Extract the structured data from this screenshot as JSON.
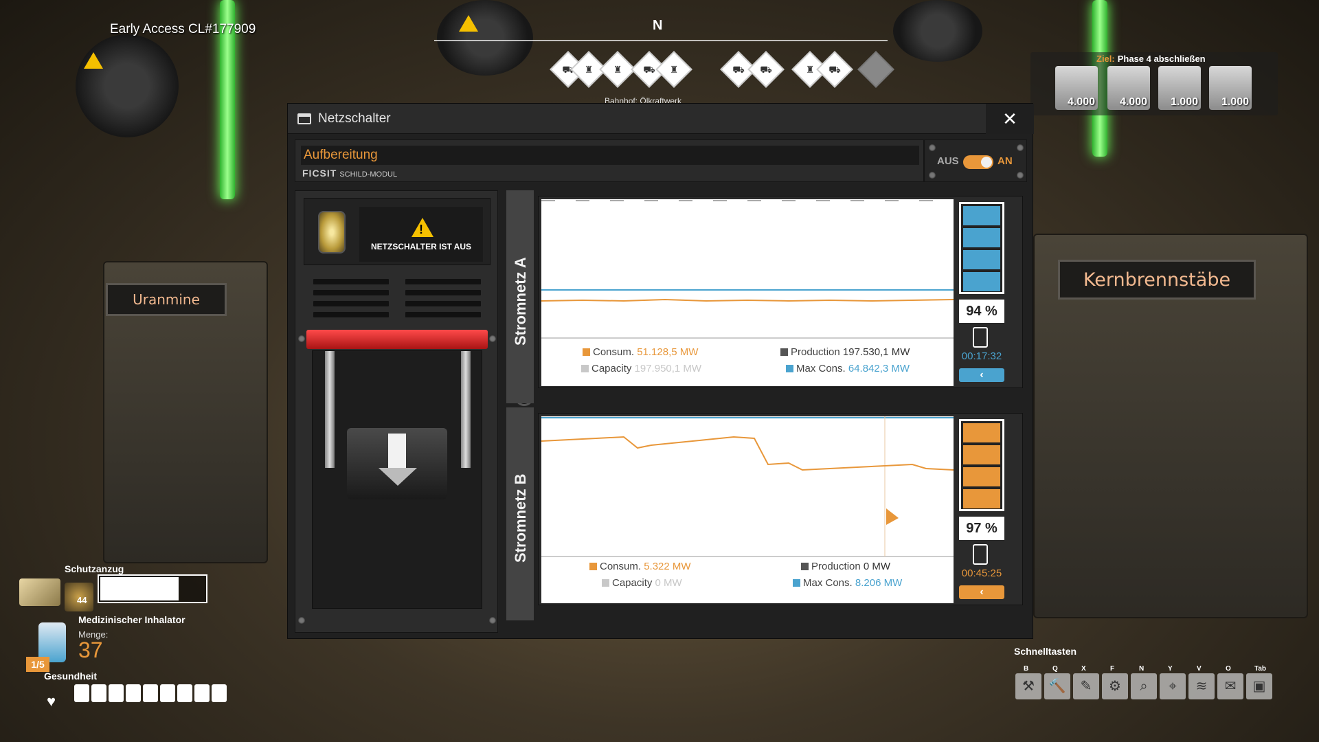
{
  "hud": {
    "build": "Early Access CL#177909",
    "compass_heading": "N",
    "compass_label": "Bahnhof: Ölkraftwerk",
    "goal": {
      "label": "Ziel:",
      "title": "Phase 4 abschließen",
      "items": [
        {
          "count": "4.000",
          "icon": "motor-icon"
        },
        {
          "count": "4.000",
          "icon": "turbomotor-icon"
        },
        {
          "count": "1.000",
          "icon": "modular-frame-icon"
        },
        {
          "count": "1.000",
          "icon": "nuclear-pasta-icon"
        }
      ]
    },
    "bg_signs": {
      "left": "Uranmine",
      "right": "Kernbrennstäbe"
    },
    "player": {
      "suit_label": "Schutzanzug",
      "suit_count": "44",
      "suit_level": 0.72,
      "inhaler_label": "Medizinischer Inhalator",
      "menge_label": "Menge:",
      "menge_value": "37",
      "inhaler_slot": "1/5",
      "health_label": "Gesundheit",
      "health_segments": 9
    },
    "quickbar": {
      "label": "Schnelltasten",
      "slots": [
        {
          "key": "B",
          "icon": "build-gun-icon",
          "glyph": "⚒"
        },
        {
          "key": "Q",
          "icon": "hammer-icon",
          "glyph": "🔨"
        },
        {
          "key": "X",
          "icon": "paint-brush-icon",
          "glyph": "✎"
        },
        {
          "key": "F",
          "icon": "factory-icon",
          "glyph": "⚙"
        },
        {
          "key": "N",
          "icon": "search-icon",
          "glyph": "⌕"
        },
        {
          "key": "Y",
          "icon": "map-marker-icon",
          "glyph": "⌖"
        },
        {
          "key": "V",
          "icon": "signal-icon",
          "glyph": "≋"
        },
        {
          "key": "O",
          "icon": "mail-icon",
          "glyph": "✉"
        },
        {
          "key": "Tab",
          "icon": "inventory-box-icon",
          "glyph": "▣"
        }
      ]
    }
  },
  "window": {
    "title": "Netzschalter",
    "close": "✕",
    "name_value": "Aufbereitung",
    "brand": "FICSIT",
    "module": "SCHILD-MODUL",
    "toggle_off": "AUS",
    "toggle_on": "AN",
    "status_text": "NETZSCHALTER IST AUS",
    "colors": {
      "accent": "#e8973a",
      "blue": "#4aa3cf",
      "production": "#555555",
      "capacity": "#c8c8c8"
    },
    "grids": [
      {
        "name": "Stromnetz A",
        "consum_label": "Consum.",
        "consum_value": "51.128,5 MW",
        "production_label": "Production",
        "production_value": "197.530,1 MW",
        "capacity_label": "Capacity",
        "capacity_value": "197.950,1 MW",
        "maxcons_label": "Max Cons.",
        "maxcons_value": "64.842,3 MW",
        "battery_pct": "94 %",
        "battery_time": "00:17:32",
        "battery_color": "#4aa3cf",
        "btn": "‹"
      },
      {
        "name": "Stromnetz B",
        "consum_label": "Consum.",
        "consum_value": "5.322 MW",
        "production_label": "Production",
        "production_value": "0 MW",
        "capacity_label": "Capacity",
        "capacity_value": "0 MW",
        "maxcons_label": "Max Cons.",
        "maxcons_value": "8.206 MW",
        "battery_pct": "97 %",
        "battery_time": "00:45:25",
        "battery_color": "#e8973a",
        "btn": "‹"
      }
    ]
  }
}
